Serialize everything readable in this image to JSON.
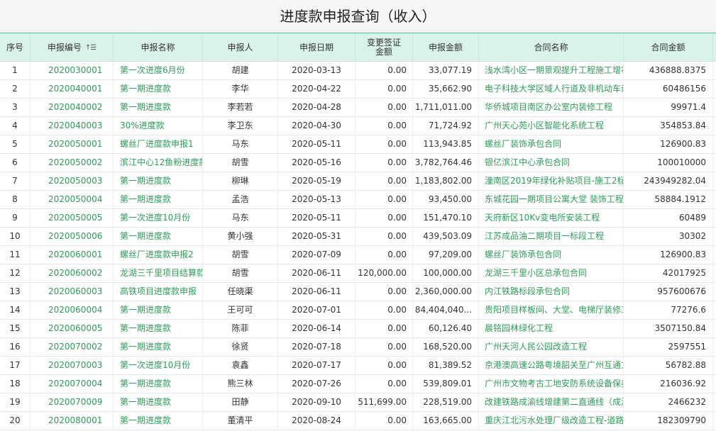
{
  "page": {
    "title": "进度款申报查询（收入）"
  },
  "table": {
    "columns": [
      "序号",
      "申报编号",
      "申报名称",
      "申报人",
      "申报日期",
      "变更签证金额",
      "申报金额",
      "合同名称",
      "合同金额"
    ],
    "sort_icon": "sort-ascending-icon",
    "accent_color": "#2e9c5a",
    "header_bg": "#d9f2ea",
    "rows": [
      {
        "no": "1",
        "code": "2020030001",
        "name": "第一次进度6月份",
        "person": "胡建",
        "date": "2020-03-13",
        "change": "0.00",
        "amount": "33,077.19",
        "contract": "浅水湾小区一期景观提升工程施工增补",
        "contract_amount": "436888.8375"
      },
      {
        "no": "2",
        "code": "2020040001",
        "name": "第一期进度款",
        "person": "李华",
        "date": "2020-04-22",
        "change": "0.00",
        "amount": "35,662.90",
        "contract": "电子科技大学区域人行道及非机动车道",
        "contract_amount": "60486156"
      },
      {
        "no": "3",
        "code": "2020040002",
        "name": "第一期进度款",
        "person": "李若若",
        "date": "2020-04-28",
        "change": "0.00",
        "amount": "1,711,011.00",
        "contract": "华侨城项目南区办公室内装修工程",
        "contract_amount": "99971.4"
      },
      {
        "no": "4",
        "code": "2020040003",
        "name": "30%进度款",
        "person": "李卫东",
        "date": "2020-04-30",
        "change": "0.00",
        "amount": "71,724.92",
        "contract": "广州天心苑小区智能化系统工程",
        "contract_amount": "354853.84"
      },
      {
        "no": "5",
        "code": "2020050001",
        "name": "螺丝厂进度款申报1",
        "person": "马东",
        "date": "2020-05-11",
        "change": "0.00",
        "amount": "113,943.85",
        "contract": "螺丝厂装饰承包合同",
        "contract_amount": "126900.83"
      },
      {
        "no": "6",
        "code": "2020050002",
        "name": "滨江中心12鱼粉进度款",
        "person": "胡雪",
        "date": "2020-05-16",
        "change": "0.00",
        "amount": "3,782,764.46",
        "contract": "银亿滨江中心承包合同",
        "contract_amount": "100010000"
      },
      {
        "no": "7",
        "code": "2020050003",
        "name": "第一期进度款",
        "person": "柳琳",
        "date": "2020-05-19",
        "change": "0.00",
        "amount": "1,183,802.00",
        "contract": "潼南区2019年绿化补贴项目-施工2标段",
        "contract_amount": "243949282.04"
      },
      {
        "no": "8",
        "code": "2020050004",
        "name": "第一期进度款",
        "person": "孟浩",
        "date": "2020-05-13",
        "change": "0.00",
        "amount": "93,450.00",
        "contract": "东城花园一期项目公寓大堂 装饰工程",
        "contract_amount": "58884.1912"
      },
      {
        "no": "9",
        "code": "2020050005",
        "name": "第一次进度10月份",
        "person": "马东",
        "date": "2020-05-11",
        "change": "0.00",
        "amount": "151,470.10",
        "contract": "天府新区10Kv变电所安装工程",
        "contract_amount": "60489"
      },
      {
        "no": "10",
        "code": "2020050006",
        "name": "第一期进度款",
        "person": "黄小强",
        "date": "2020-05-31",
        "change": "0.00",
        "amount": "439,503.09",
        "contract": "江苏成品油二期项目一标段工程",
        "contract_amount": "30302"
      },
      {
        "no": "11",
        "code": "2020060001",
        "name": "螺丝厂进度款申报2",
        "person": "胡雪",
        "date": "2020-07-09",
        "change": "0.00",
        "amount": "97,209.00",
        "contract": "螺丝厂装饰承包合同",
        "contract_amount": "126900.83"
      },
      {
        "no": "12",
        "code": "2020060002",
        "name": "龙湖三千里项目结算款",
        "person": "胡雪",
        "date": "2020-06-11",
        "change": "120,000.00",
        "amount": "100,000.00",
        "contract": "龙湖三千里小区总承包合同",
        "contract_amount": "42017925"
      },
      {
        "no": "13",
        "code": "2020060003",
        "name": "高铁项目进度款申报",
        "person": "任晓渠",
        "date": "2020-06-11",
        "change": "0.00",
        "amount": "2,360,000.00",
        "contract": "内江铁路标段承包合同",
        "contract_amount": "957600676"
      },
      {
        "no": "14",
        "code": "2020060004",
        "name": "第一期进度款",
        "person": "王可可",
        "date": "2020-07-01",
        "change": "0.00",
        "amount": "84,404,040...",
        "contract": "贵阳项目样板间、大堂、电梯厅装修工程",
        "contract_amount": "77276.6"
      },
      {
        "no": "15",
        "code": "2020060005",
        "name": "第一期进度款",
        "person": "陈菲",
        "date": "2020-06-14",
        "change": "0.00",
        "amount": "60,126.40",
        "contract": "晨铭园林绿化工程",
        "contract_amount": "3507150.84"
      },
      {
        "no": "16",
        "code": "2020070002",
        "name": "第一期进度款",
        "person": "徐贤",
        "date": "2020-07-18",
        "change": "0.00",
        "amount": "168,520.00",
        "contract": "广州天河人民公园改造工程",
        "contract_amount": "2597551"
      },
      {
        "no": "17",
        "code": "2020070003",
        "name": "第一次进度10月份",
        "person": "袁鑫",
        "date": "2020-07-17",
        "change": "0.00",
        "amount": "81,389.52",
        "contract": "京港澳高速公路粤境韶关至广州互通立交",
        "contract_amount": "56782.88"
      },
      {
        "no": "18",
        "code": "2020070004",
        "name": "第一期进度款",
        "person": "熊三林",
        "date": "2020-07-26",
        "change": "0.00",
        "amount": "539,809.01",
        "contract": "广州市文物考古工地安防系统设备保养",
        "contract_amount": "216036.92"
      },
      {
        "no": "19",
        "code": "2020070009",
        "name": "第一期进度款",
        "person": "田静",
        "date": "2020-09-10",
        "change": "511,699.00",
        "amount": "228,519.00",
        "contract": "改建铁路成渝线增建第二直通线（成渝段）",
        "contract_amount": "2466232"
      },
      {
        "no": "20",
        "code": "2020080001",
        "name": "第一期进度款",
        "person": "董清平",
        "date": "2020-08-24",
        "change": "0.00",
        "amount": "163,665.00",
        "contract": "重庆江北污水处理厂级改造工程-道路",
        "contract_amount": "182309790"
      }
    ]
  }
}
